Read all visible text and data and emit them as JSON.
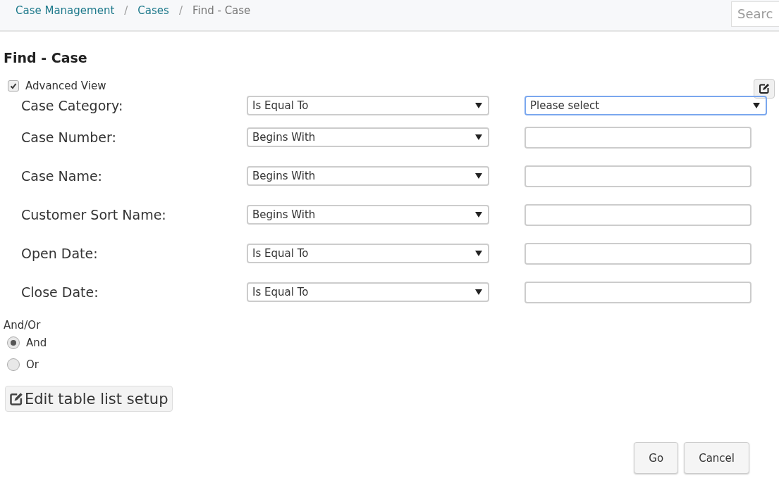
{
  "breadcrumbs": [
    {
      "label": "Case Management",
      "kind": "link"
    },
    {
      "label": "Cases",
      "kind": "link"
    },
    {
      "label": "Find - Case",
      "kind": "current"
    }
  ],
  "breadcrumb_separator": "/",
  "search": {
    "placeholder": "Searc"
  },
  "title": "Find - Case",
  "advanced_view": {
    "label": "Advanced View",
    "checked": true
  },
  "criteria": [
    {
      "label": "Case Category:",
      "operator": "Is Equal To",
      "kind": "select",
      "value": "Please select",
      "focused": true
    },
    {
      "label": "Case Number:",
      "operator": "Begins With",
      "kind": "text",
      "focused": false
    },
    {
      "label": "Case Name:",
      "operator": "Begins With",
      "kind": "text",
      "focused": false
    },
    {
      "label": "Customer Sort Name:",
      "operator": "Begins With",
      "kind": "text",
      "focused": false
    },
    {
      "label": "Open Date:",
      "operator": "Is Equal To",
      "kind": "text",
      "focused": false
    },
    {
      "label": "Close Date:",
      "operator": "Is Equal To",
      "kind": "text",
      "focused": false
    }
  ],
  "and_or": {
    "label": "And/Or",
    "options": [
      {
        "label": "And",
        "selected": true
      },
      {
        "label": "Or",
        "selected": false
      }
    ]
  },
  "edit_table_button": "Edit table list setup",
  "buttons": [
    "Go",
    "Cancel"
  ]
}
